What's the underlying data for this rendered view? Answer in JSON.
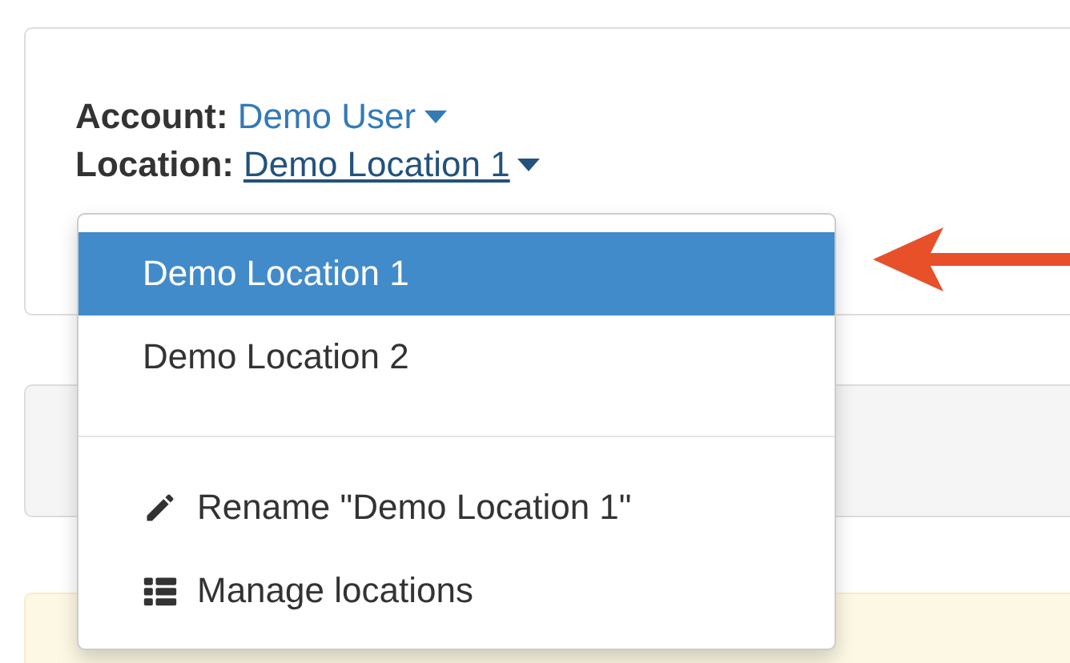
{
  "account": {
    "label": "Account:",
    "value": "Demo User"
  },
  "location": {
    "label": "Location:",
    "value": "Demo Location 1",
    "expanded": true
  },
  "location_menu": {
    "locations": [
      {
        "label": "Demo Location 1",
        "selected": true
      },
      {
        "label": "Demo Location 2",
        "selected": false
      }
    ],
    "actions": [
      {
        "kind": "rename",
        "label": "Rename \"Demo Location 1\""
      },
      {
        "kind": "manage",
        "label": "Manage locations"
      }
    ]
  }
}
